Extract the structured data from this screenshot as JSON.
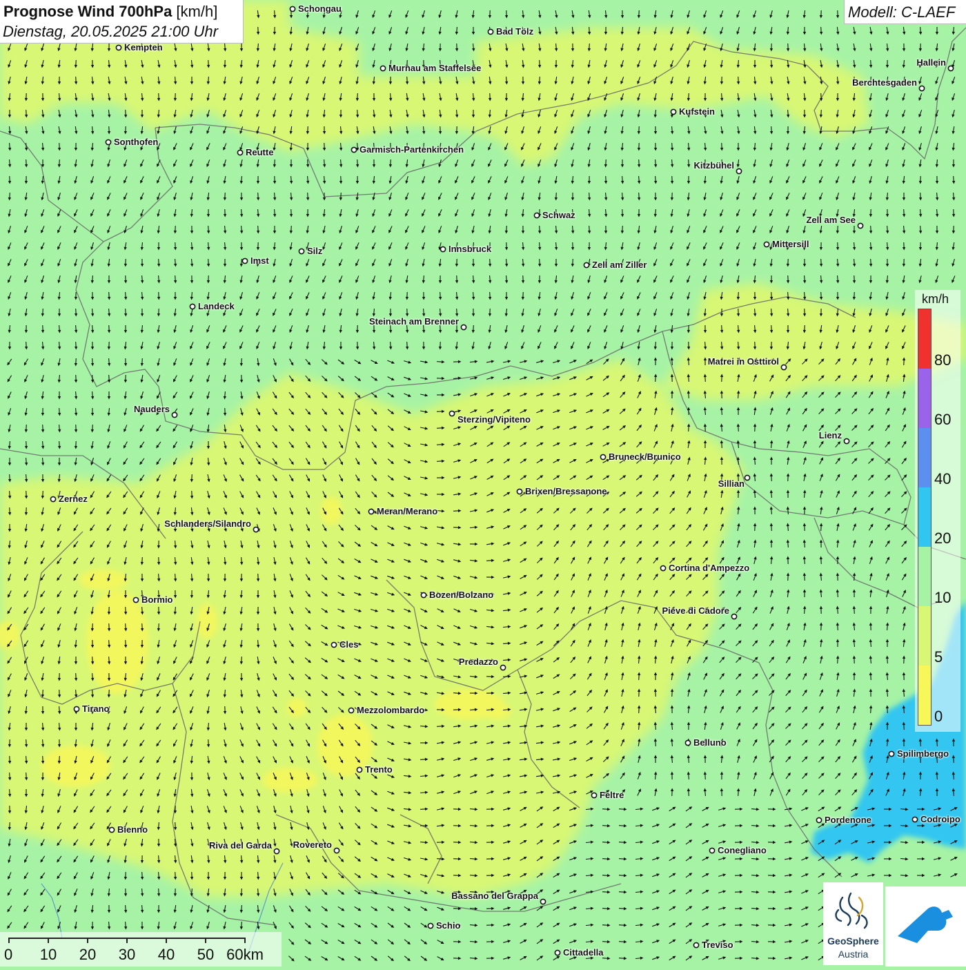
{
  "header": {
    "title_bold": "Prognose Wind 700hPa",
    "title_unit": " [km/h]",
    "subtitle": "Dienstag, 20.05.2025 21:00 Uhr",
    "model": "Modell: C-LAEF"
  },
  "legend": {
    "unit": "km/h",
    "levels": [
      {
        "label": "0",
        "color": "#f7f75a"
      },
      {
        "label": "5",
        "color": "#d8f774"
      },
      {
        "label": "10",
        "color": "#a6f3a6"
      },
      {
        "label": "20",
        "color": "#30c6f0"
      },
      {
        "label": "40",
        "color": "#5b8ff0"
      },
      {
        "label": "60",
        "color": "#9b63ea"
      },
      {
        "label": "80",
        "color": "#f0322f"
      }
    ]
  },
  "colors": {
    "calm": "#f7f75a",
    "light": "#d8f774",
    "moderate": "#a6f3a6",
    "strong": "#30c6f0",
    "border": "#666666",
    "arrow": "#111111"
  },
  "cities": [
    {
      "name": "Schongau"
    },
    {
      "name": "Bad Tölz"
    },
    {
      "name": "Kempten"
    },
    {
      "name": "Murnau am Staffelsee"
    },
    {
      "name": "Hallein"
    },
    {
      "name": "Berchtesgaden"
    },
    {
      "name": "Kufstein"
    },
    {
      "name": "Sonthofen"
    },
    {
      "name": "Reutte"
    },
    {
      "name": "Garmisch-Partenkirchen"
    },
    {
      "name": "Kitzbühel"
    },
    {
      "name": "Schwaz"
    },
    {
      "name": "Zell am See"
    },
    {
      "name": "Mittersill"
    },
    {
      "name": "Silz"
    },
    {
      "name": "Innsbruck"
    },
    {
      "name": "Imst"
    },
    {
      "name": "Zell am Ziller"
    },
    {
      "name": "Landeck"
    },
    {
      "name": "Steinach am Brenner"
    },
    {
      "name": "Matrei in Osttirol"
    },
    {
      "name": "Nauders"
    },
    {
      "name": "Sterzing/Vipiteno"
    },
    {
      "name": "Lienz"
    },
    {
      "name": "Bruneck/Brunico"
    },
    {
      "name": "Sillian"
    },
    {
      "name": "Brixen/Bressanone"
    },
    {
      "name": "Zernez"
    },
    {
      "name": "Meran/Merano"
    },
    {
      "name": "Schlanders/Silandro"
    },
    {
      "name": "Cortina d'Ampezzo"
    },
    {
      "name": "Bozen/Bolzano"
    },
    {
      "name": "Bormio"
    },
    {
      "name": "Pieve di Cadore"
    },
    {
      "name": "Cles"
    },
    {
      "name": "Predazzo"
    },
    {
      "name": "Tirano"
    },
    {
      "name": "Mezzolombardo"
    },
    {
      "name": "Belluno"
    },
    {
      "name": "Spilimbergo"
    },
    {
      "name": "Trento"
    },
    {
      "name": "Feltre"
    },
    {
      "name": "Pordenone"
    },
    {
      "name": "Codroipo"
    },
    {
      "name": "Bienno"
    },
    {
      "name": "Riva del Garda"
    },
    {
      "name": "Rovereto"
    },
    {
      "name": "Conegliano"
    },
    {
      "name": "Bassano del Grappa"
    },
    {
      "name": "Schio"
    },
    {
      "name": "Treviso"
    },
    {
      "name": "Cittadella"
    }
  ],
  "scalebar": {
    "labels": [
      "0",
      "10",
      "20",
      "30",
      "40",
      "50",
      "60km"
    ]
  },
  "logo": {
    "name": "GeoSphere",
    "sub": "Austria"
  }
}
